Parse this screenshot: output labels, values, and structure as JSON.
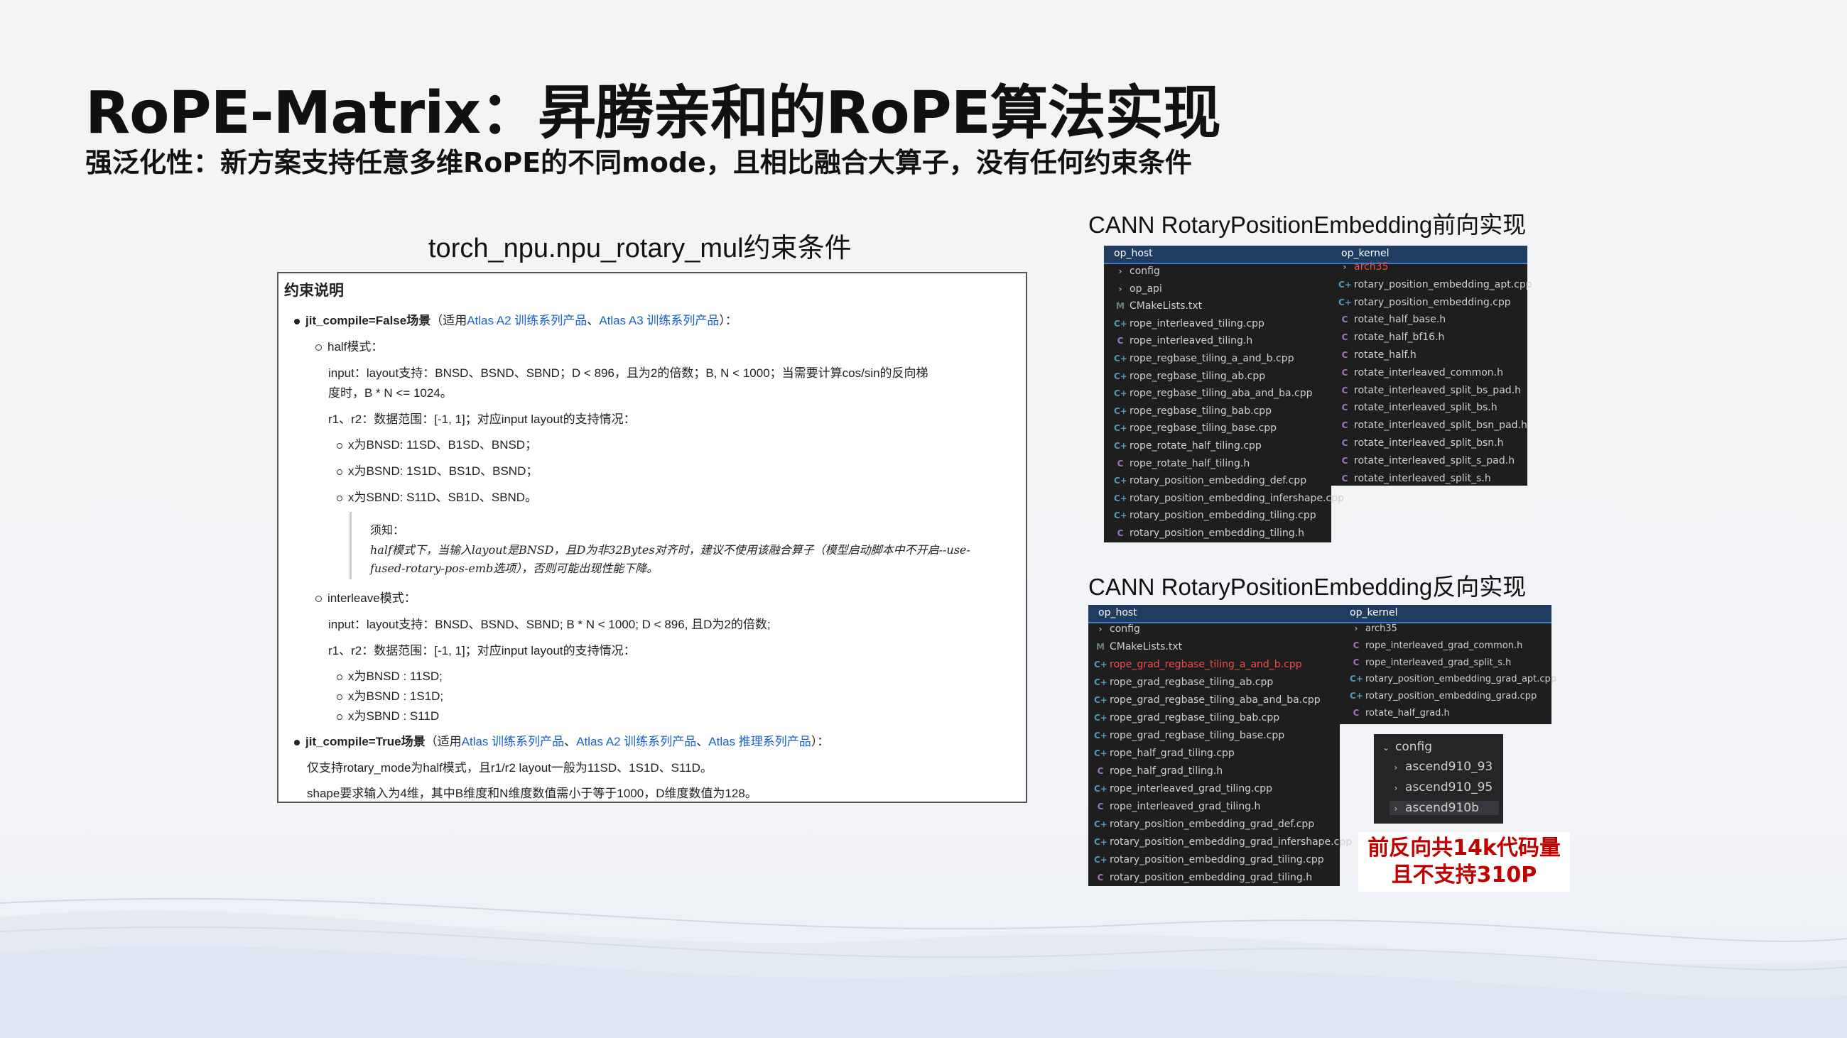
{
  "title": "RoPE-Matrix：昇腾亲和的RoPE算法实现",
  "subtitle": "强泛化性：新方案支持任意多维RoPE的不同mode，且相比融合大算子，没有任何约束条件",
  "left_caption": "torch_npu.npu_rotary_mul约束条件",
  "forward_caption": "CANN RotaryPositionEmbedding前向实现",
  "backward_caption": "CANN RotaryPositionEmbedding反向实现",
  "callout": [
    "前反向共14k代码量",
    "且不支持310P"
  ],
  "doc": {
    "header": "约束说明",
    "l1a": "jit_compile=False场景",
    "l1b": "（适用",
    "l1c": "Atlas A2 训练系列产品",
    "l1d": "、",
    "l1e": "Atlas A3 训练系列产品",
    "l1f": "）：",
    "l2": "half模式：",
    "l3": "input：layout支持：BNSD、BSND、SBND；D < 896，且为2的倍数；B, N < 1000；当需要计算cos/sin的反向梯",
    "l4": "度时，B * N <= 1024。",
    "l5": "r1、r2：数据范围：[-1, 1]；对应input layout的支持情况：",
    "l6": "x为BNSD: 11SD、B1SD、BNSD；",
    "l7": "x为BSND: 1S1D、BS1D、BSND；",
    "l8": "x为SBND: S11D、SB1D、SBND。",
    "n1": "须知：",
    "n2": "half模式下，当输入layout是BNSD，且D为非32Bytes对齐时，建议不使用该融合算子（模型启动脚本中不开启--use-",
    "n3": "fused-rotary-pos-emb选项），否则可能出现性能下降。",
    "l9": "interleave模式：",
    "l10": "input：layout支持：BNSD、BSND、SBND; B * N < 1000; D < 896, 且D为2的倍数;",
    "l11": "r1、r2：数据范围：[-1, 1]；对应input layout的支持情况：",
    "l12": "x为BNSD : 11SD;",
    "l13": "x为BSND : 1S1D;",
    "l14": "x为SBND : S11D",
    "l15a": "jit_compile=True场景",
    "l15b": "（适用",
    "l15c": "Atlas 训练系列产品",
    "l15d": "、",
    "l15e": "Atlas A2 训练系列产品",
    "l15f": "、",
    "l15g": "Atlas 推理系列产品",
    "l15h": "）：",
    "l16": "仅支持rotary_mode为half模式，且r1/r2 layout一般为11SD、1S1D、S11D。",
    "l17": "shape要求输入为4维，其中B维度和N维度数值需小于等于1000，D维度数值为128。"
  },
  "fwd_host": {
    "header": "op_host",
    "items": [
      {
        "icon": "chevron",
        "label": "config"
      },
      {
        "icon": "chevron",
        "label": "op_api"
      },
      {
        "icon": "M",
        "label": "CMakeLists.txt"
      },
      {
        "icon": "C++",
        "label": "rope_interleaved_tiling.cpp"
      },
      {
        "icon": "C",
        "label": "rope_interleaved_tiling.h"
      },
      {
        "icon": "C++",
        "label": "rope_regbase_tiling_a_and_b.cpp"
      },
      {
        "icon": "C++",
        "label": "rope_regbase_tiling_ab.cpp"
      },
      {
        "icon": "C++",
        "label": "rope_regbase_tiling_aba_and_ba.cpp"
      },
      {
        "icon": "C++",
        "label": "rope_regbase_tiling_bab.cpp"
      },
      {
        "icon": "C++",
        "label": "rope_regbase_tiling_base.cpp"
      },
      {
        "icon": "C++",
        "label": "rope_rotate_half_tiling.cpp"
      },
      {
        "icon": "C",
        "label": "rope_rotate_half_tiling.h"
      },
      {
        "icon": "C++",
        "label": "rotary_position_embedding_def.cpp"
      },
      {
        "icon": "C++",
        "label": "rotary_position_embedding_infershape.cpp"
      },
      {
        "icon": "C++",
        "label": "rotary_position_embedding_tiling.cpp"
      },
      {
        "icon": "C",
        "label": "rotary_position_embedding_tiling.h"
      }
    ]
  },
  "fwd_kernel": {
    "header": "op_kernel",
    "items": [
      {
        "icon": "chevron",
        "label": "arch35",
        "red": true
      },
      {
        "icon": "C++",
        "label": "rotary_position_embedding_apt.cpp"
      },
      {
        "icon": "C++",
        "label": "rotary_position_embedding.cpp"
      },
      {
        "icon": "C",
        "label": "rotate_half_base.h"
      },
      {
        "icon": "C",
        "label": "rotate_half_bf16.h"
      },
      {
        "icon": "C",
        "label": "rotate_half.h"
      },
      {
        "icon": "C",
        "label": "rotate_interleaved_common.h"
      },
      {
        "icon": "C",
        "label": "rotate_interleaved_split_bs_pad.h"
      },
      {
        "icon": "C",
        "label": "rotate_interleaved_split_bs.h"
      },
      {
        "icon": "C",
        "label": "rotate_interleaved_split_bsn_pad.h"
      },
      {
        "icon": "C",
        "label": "rotate_interleaved_split_bsn.h"
      },
      {
        "icon": "C",
        "label": "rotate_interleaved_split_s_pad.h"
      },
      {
        "icon": "C",
        "label": "rotate_interleaved_split_s.h"
      }
    ]
  },
  "bwd_host": {
    "header": "op_host",
    "items": [
      {
        "icon": "chevron",
        "label": "config"
      },
      {
        "icon": "M",
        "label": "CMakeLists.txt"
      },
      {
        "icon": "C++",
        "label": "rope_grad_regbase_tiling_a_and_b.cpp",
        "red": true
      },
      {
        "icon": "C++",
        "label": "rope_grad_regbase_tiling_ab.cpp"
      },
      {
        "icon": "C++",
        "label": "rope_grad_regbase_tiling_aba_and_ba.cpp"
      },
      {
        "icon": "C++",
        "label": "rope_grad_regbase_tiling_bab.cpp"
      },
      {
        "icon": "C++",
        "label": "rope_grad_regbase_tiling_base.cpp"
      },
      {
        "icon": "C++",
        "label": "rope_half_grad_tiling.cpp"
      },
      {
        "icon": "C",
        "label": "rope_half_grad_tiling.h"
      },
      {
        "icon": "C++",
        "label": "rope_interleaved_grad_tiling.cpp"
      },
      {
        "icon": "C",
        "label": "rope_interleaved_grad_tiling.h"
      },
      {
        "icon": "C++",
        "label": "rotary_position_embedding_grad_def.cpp"
      },
      {
        "icon": "C++",
        "label": "rotary_position_embedding_grad_infershape.cpp"
      },
      {
        "icon": "C++",
        "label": "rotary_position_embedding_grad_tiling.cpp"
      },
      {
        "icon": "C",
        "label": "rotary_position_embedding_grad_tiling.h"
      }
    ]
  },
  "bwd_kernel": {
    "header": "op_kernel",
    "items": [
      {
        "icon": "chevron",
        "label": "arch35"
      },
      {
        "icon": "C",
        "label": "rope_interleaved_grad_common.h"
      },
      {
        "icon": "C",
        "label": "rope_interleaved_grad_split_s.h"
      },
      {
        "icon": "C++",
        "label": "rotary_position_embedding_grad_apt.cpp"
      },
      {
        "icon": "C++",
        "label": "rotary_position_embedding_grad.cpp"
      },
      {
        "icon": "C",
        "label": "rotate_half_grad.h"
      }
    ]
  },
  "config_tree": {
    "header": "config",
    "items": [
      "ascend910_93",
      "ascend910_95",
      "ascend910b"
    ]
  }
}
